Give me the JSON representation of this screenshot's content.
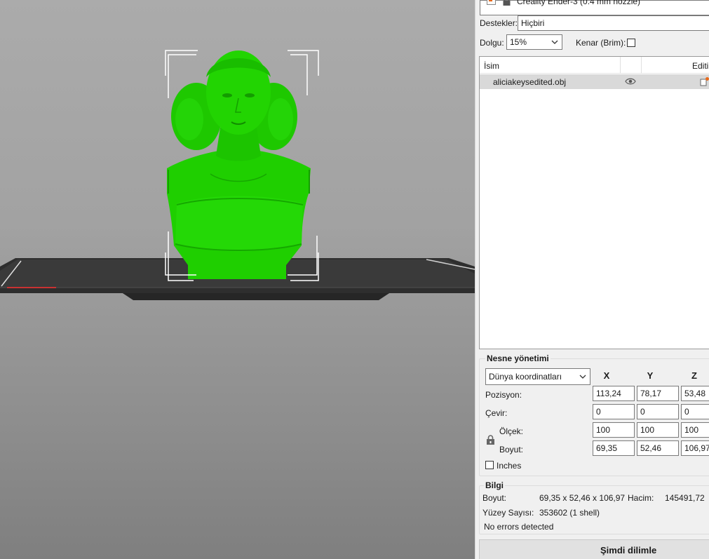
{
  "printer": {
    "name": "Creality Ender-3 (0.4 mm nozzle)"
  },
  "supports": {
    "label": "Destekler:",
    "value": "Hiçbiri"
  },
  "infill": {
    "label": "Dolgu:",
    "value": "15%"
  },
  "brim": {
    "label": "Kenar (Brim):",
    "checked": false
  },
  "object_list": {
    "columns": [
      "İsim",
      "Editin"
    ],
    "rows": [
      {
        "name": "aliciakeysedited.obj",
        "selected": true
      }
    ]
  },
  "object_manipulation": {
    "title": "Nesne yönetimi",
    "coordinate_system": "Dünya koordinatları",
    "axes": [
      "X",
      "Y",
      "Z"
    ],
    "rows": [
      {
        "label": "Pozisyon:",
        "values": [
          "113,24",
          "78,17",
          "53,48"
        ]
      },
      {
        "label": "Çevir:",
        "values": [
          "0",
          "0",
          "0"
        ]
      },
      {
        "label": "Ölçek:",
        "values": [
          "100",
          "100",
          "100"
        ]
      },
      {
        "label": "Boyut:",
        "values": [
          "69,35",
          "52,46",
          "106,97"
        ]
      }
    ],
    "inches_label": "Inches",
    "inches_checked": false
  },
  "info": {
    "title": "Bilgi",
    "size_label": "Boyut:",
    "size_value": "69,35 x 52,46 x 106,97",
    "volume_label": "Hacim:",
    "volume_value": "145491,72",
    "facets_label": "Yüzey Sayısı:",
    "facets_value": "353602 (1 shell)",
    "errors": "No errors detected"
  },
  "slice_button": "Şimdi dilimle",
  "colors": {
    "model": "#22dd00",
    "model_shadow": "#14a800",
    "bed": "#3c3c3c",
    "selection": "#ffffff"
  }
}
